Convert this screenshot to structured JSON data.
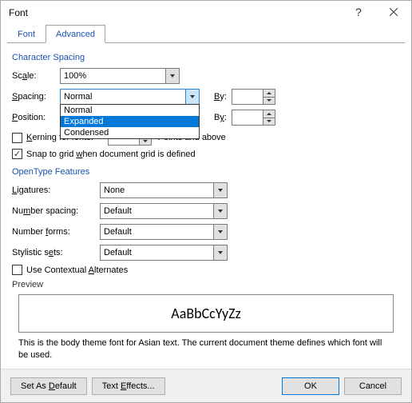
{
  "title": "Font",
  "tabs": {
    "font": "Font",
    "advanced": "Advanced"
  },
  "charSpacing": {
    "groupLabel": "Character Spacing",
    "scaleLabel": "Scale:",
    "scaleValue": "100%",
    "spacingLabel": "Spacing:",
    "spacingValue": "Normal",
    "spacingOptions": [
      "Normal",
      "Expanded",
      "Condensed"
    ],
    "positionLabel": "Position:",
    "byLabel": "By:",
    "kerningLabel": "Kerning for fonts:",
    "pointsAndAbove": "Points and above",
    "snapLabel": "Snap to grid when document grid is defined"
  },
  "openType": {
    "groupLabel": "OpenType Features",
    "ligaturesLabel": "Ligatures:",
    "ligaturesValue": "None",
    "numSpacingLabel": "Number spacing:",
    "numSpacingValue": "Default",
    "numFormsLabel": "Number forms:",
    "numFormsValue": "Default",
    "stylisticLabel": "Stylistic sets:",
    "stylisticValue": "Default",
    "contextualLabel": "Use Contextual Alternates"
  },
  "preview": {
    "label": "Preview",
    "sample": "AaBbCcYyZz",
    "description": "This is the body theme font for Asian text. The current document theme defines which font will be used."
  },
  "buttons": {
    "setDefault": "Set As Default",
    "textEffects": "Text Effects...",
    "ok": "OK",
    "cancel": "Cancel"
  }
}
